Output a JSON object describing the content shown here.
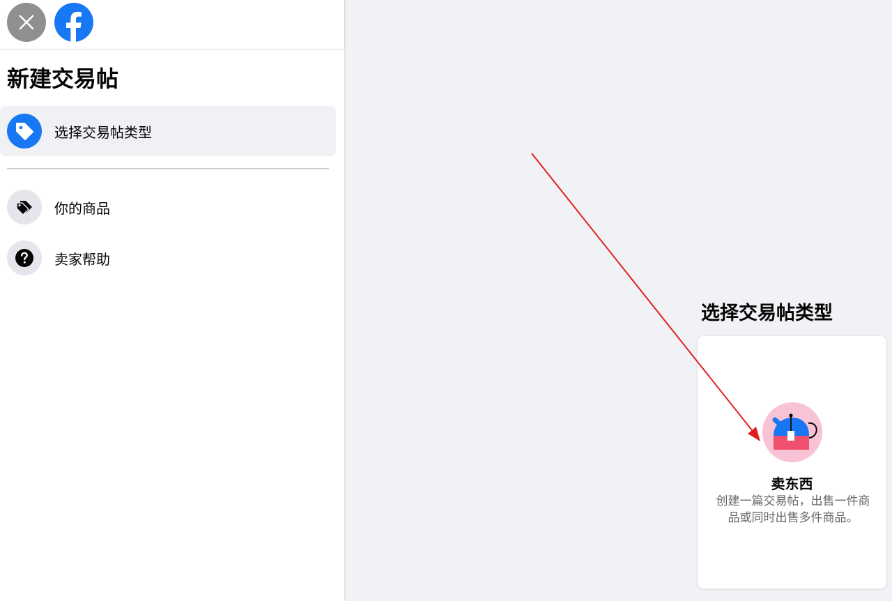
{
  "header": {
    "close_icon": "close-icon",
    "logo_icon": "facebook-logo-icon"
  },
  "sidebar": {
    "title": "新建交易帖",
    "items": [
      {
        "label": "选择交易帖类型",
        "icon": "price-tag-icon",
        "active": true
      },
      {
        "label": "你的商品",
        "icon": "tags-icon",
        "active": false
      },
      {
        "label": "卖家帮助",
        "icon": "question-icon",
        "active": false
      }
    ]
  },
  "main": {
    "section_title": "选择交易帖类型",
    "card": {
      "title": "卖东西",
      "description": "创建一篇交易帖，出售一件商品或同时出售多件商品。",
      "icon": "teapot-illustration-icon"
    }
  },
  "colors": {
    "accent": "#1877f2",
    "annotation_arrow": "#e02020",
    "illustration_bg": "#f9c3d6"
  }
}
